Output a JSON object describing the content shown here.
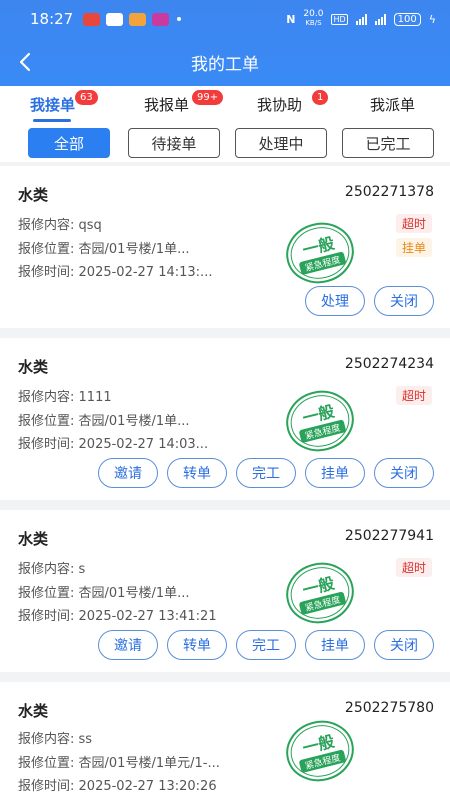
{
  "status_bar": {
    "time": "18:27",
    "net_speed_top": "20.0",
    "net_speed_unit": "KB/S",
    "hd": "HD",
    "battery": "100"
  },
  "nav": {
    "title": "我的工单"
  },
  "tabs": [
    {
      "label": "我接单",
      "badge": "63"
    },
    {
      "label": "我报单",
      "badge": "99+"
    },
    {
      "label": "我协助",
      "badge": "1"
    },
    {
      "label": "我派单",
      "badge": ""
    }
  ],
  "filters": [
    "全部",
    "待接单",
    "处理中",
    "已完工"
  ],
  "labels": {
    "content": "报修内容:",
    "location": "报修位置:",
    "time": "报修时间:"
  },
  "stamp": {
    "level": "一般",
    "caption": "紧急程度",
    "color": "#2aa35a"
  },
  "orders": [
    {
      "category": "水类",
      "number": "2502271378",
      "content": "qsq",
      "location": "杏园/01号楼/1单...",
      "time": "2025-02-27 14:13:...",
      "tags": [
        "超时",
        "挂单"
      ],
      "actions": [
        "处理",
        "关闭"
      ]
    },
    {
      "category": "水类",
      "number": "2502274234",
      "content": "1111",
      "location": "杏园/01号楼/1单...",
      "time": "2025-02-27 14:03...",
      "tags": [
        "超时"
      ],
      "actions": [
        "邀请",
        "转单",
        "完工",
        "挂单",
        "关闭"
      ]
    },
    {
      "category": "水类",
      "number": "2502277941",
      "content": "s",
      "location": "杏园/01号楼/1单...",
      "time": "2025-02-27 13:41:21",
      "tags": [
        "超时"
      ],
      "actions": [
        "邀请",
        "转单",
        "完工",
        "挂单",
        "关闭"
      ]
    },
    {
      "category": "水类",
      "number": "2502275780",
      "content": "ss",
      "location": "杏园/01号楼/1单元/1-...",
      "time": "2025-02-27 13:20:26",
      "tags": [],
      "actions": []
    }
  ],
  "colors": {
    "primary": "#2b6fe0",
    "header": "#3a8af5",
    "badge": "#f23c3c",
    "overdue": "#d9302c",
    "pending": "#e98a17"
  }
}
